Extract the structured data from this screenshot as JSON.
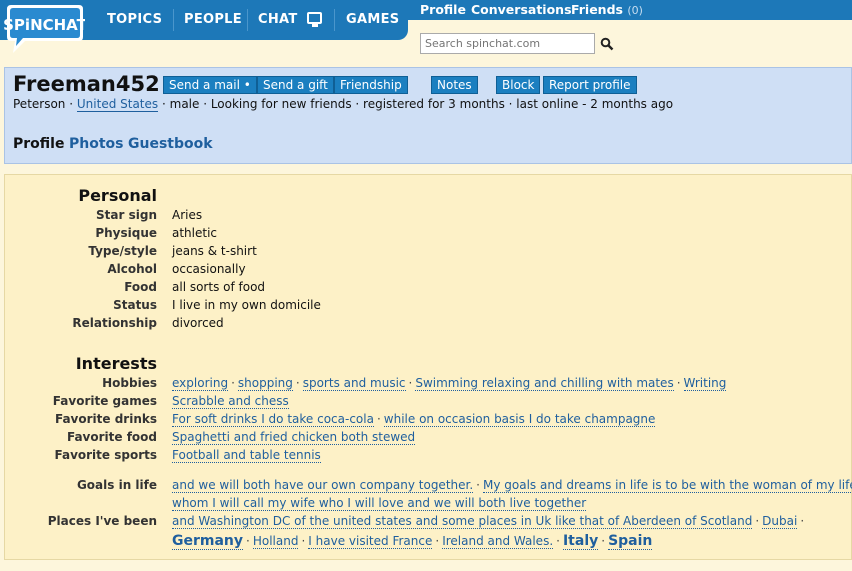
{
  "logo": {
    "text": "SPiNCHAT"
  },
  "nav": {
    "topics": "TOPICS",
    "people": "PEOPLE",
    "chat": "CHAT",
    "games": "GAMES"
  },
  "toplinks": {
    "profile": "Profile",
    "conversations": "Conversations",
    "friends": "Friends",
    "friends_count": "(0)"
  },
  "search": {
    "placeholder": "Search spinchat.com"
  },
  "profile": {
    "username": "Freeman452",
    "actions": [
      "Send a mail •",
      "Send a gift",
      "Friendship",
      "Notes",
      "Block",
      "Report profile"
    ],
    "info": {
      "name": "Peterson",
      "country": "United States",
      "rest": "male · Looking for new friends · registered for 3 months · last online - 2 months ago"
    },
    "tabs": [
      "Profile",
      "Photos",
      "Guestbook"
    ]
  },
  "personal": {
    "title": "Personal",
    "rows": [
      {
        "label": "Star sign",
        "value": "Aries"
      },
      {
        "label": "Physique",
        "value": "athletic"
      },
      {
        "label": "Type/style",
        "value": "jeans & t-shirt"
      },
      {
        "label": "Alcohol",
        "value": "occasionally"
      },
      {
        "label": "Food",
        "value": "all sorts of food"
      },
      {
        "label": "Status",
        "value": "I live in my own domicile"
      },
      {
        "label": "Relationship",
        "value": "divorced"
      }
    ]
  },
  "interests": {
    "title": "Interests",
    "hobbies": {
      "label": "Hobbies",
      "items": [
        "exploring",
        "shopping",
        "sports and music",
        "Swimming relaxing and chilling with mates",
        "Writing"
      ]
    },
    "games": {
      "label": "Favorite games",
      "items": [
        "Scrabble and chess"
      ]
    },
    "drinks": {
      "label": "Favorite drinks",
      "items": [
        "For soft drinks I do take coca-cola",
        "while on occasion basis I do take champagne"
      ]
    },
    "food": {
      "label": "Favorite food",
      "items": [
        "Spaghetti and fried chicken both stewed"
      ]
    },
    "sports": {
      "label": "Favorite sports",
      "items": [
        "Football and table tennis"
      ]
    },
    "goals": {
      "label": "Goals in life",
      "item1": "and we will both have our own company together.",
      "item2a": "My goals and dreams in life is to be with the woman of my life",
      "item2b": "whom I will call my wife who I will love and we will both live together"
    },
    "places": {
      "label": "Places I've been",
      "item1": "and Washington DC of the united states and some places in Uk like that of Aberdeen of Scotland",
      "item2": "Dubai",
      "germany": "Germany",
      "holland": "Holland",
      "france": "I have visited France",
      "ireland": "Ireland and Wales.",
      "italy": "Italy",
      "spain": "Spain"
    }
  },
  "colors": {
    "nav_blue": "#1d78b8",
    "header_panel": "#cfdff5",
    "content_panel": "#fdf1c7",
    "link": "#1f5f9e"
  }
}
